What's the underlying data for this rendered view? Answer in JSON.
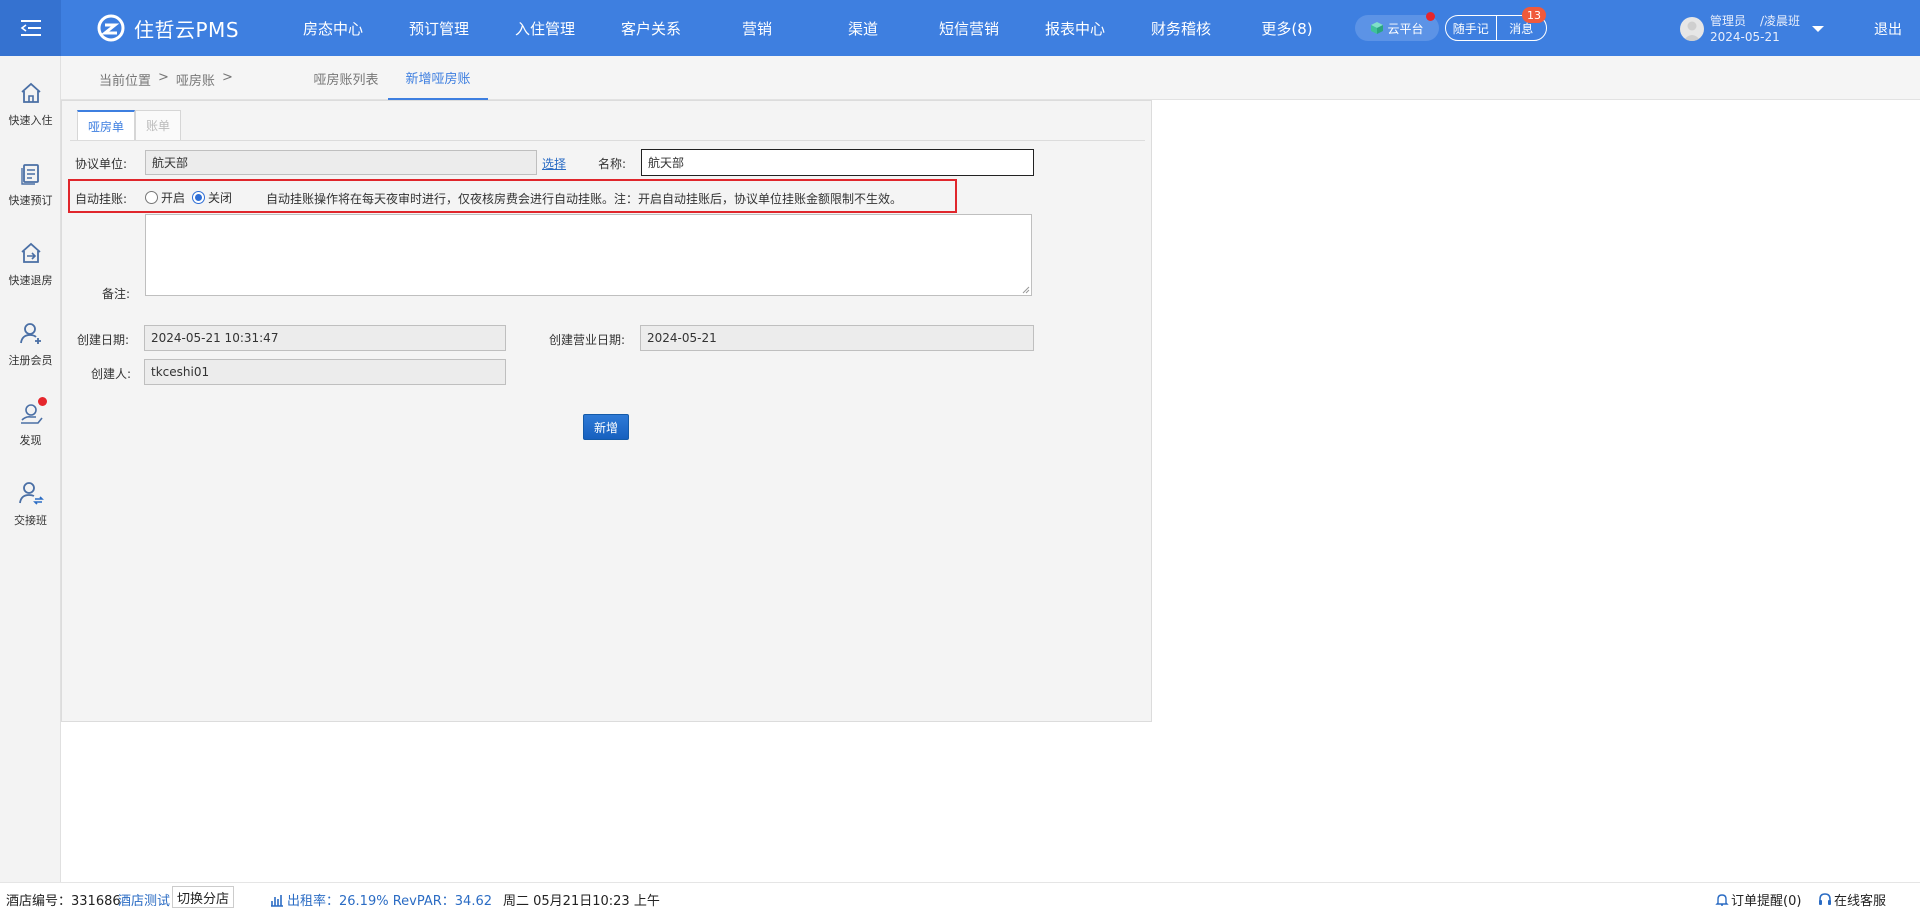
{
  "header": {
    "brand": "住哲云PMS",
    "nav": [
      "房态中心",
      "预订管理",
      "入住管理",
      "客户关系",
      "营销",
      "渠道",
      "短信营销",
      "报表中心",
      "财务稽核",
      "更多(8)"
    ],
    "cloud_label": "云平台",
    "notes_label": "随手记",
    "messages_label": "消息",
    "messages_count": "13",
    "user_role": "管理员",
    "user_shift": "/凌晨班",
    "user_date": "2024-05-21",
    "logout_label": "退出",
    "colors": {
      "bar": "#3e7fe0",
      "accent_red": "#e0262c"
    }
  },
  "sidebar": {
    "items": [
      {
        "label": "快速入住",
        "icon": "home-icon"
      },
      {
        "label": "快速预订",
        "icon": "clipboard-icon"
      },
      {
        "label": "快速退房",
        "icon": "checkout-icon"
      },
      {
        "label": "注册会员",
        "icon": "add-user-icon"
      },
      {
        "label": "发现",
        "icon": "discover-icon"
      },
      {
        "label": "交接班",
        "icon": "shift-handover-icon"
      }
    ]
  },
  "breadcrumb": {
    "prefix": "当前位置",
    "sep1": ">",
    "item": "哑房账",
    "sep2": ">"
  },
  "page_tabs": {
    "list": "哑房账列表",
    "new": "新增哑房账"
  },
  "form": {
    "subtabs": {
      "dummy_room": "哑房单",
      "bill": "账单"
    },
    "agreement_unit_label": "协议单位:",
    "agreement_unit_value": "航天部",
    "select_link": "选择",
    "name_label": "名称:",
    "name_value": "航天部",
    "auto_bill_label": "自动挂账:",
    "auto_bill_on": "开启",
    "auto_bill_off": "关闭",
    "auto_bill_selected": "关闭",
    "auto_bill_note": "自动挂账操作将在每天夜审时进行，仅夜核房费会进行自动挂账。注：开启自动挂账后，协议单位挂账金额限制不生效。",
    "remark_label": "备注:",
    "created_date_label": "创建日期:",
    "created_date_value": "2024-05-21 10:31:47",
    "created_biz_date_label": "创建营业日期:",
    "created_biz_date_value": "2024-05-21",
    "creator_label": "创建人:",
    "creator_value": "tkceshi01",
    "submit_label": "新增"
  },
  "statusbar": {
    "hotel_no_label": "酒店编号：331686",
    "hotel_name": "酒店测试",
    "switch_label": "切换分店",
    "occupancy": "出租率：26.19% RevPAR：34.62",
    "datetime": "周二 05月21日10:23 上午",
    "order_remind": "订单提醒(0)",
    "online_service": "在线客服"
  }
}
